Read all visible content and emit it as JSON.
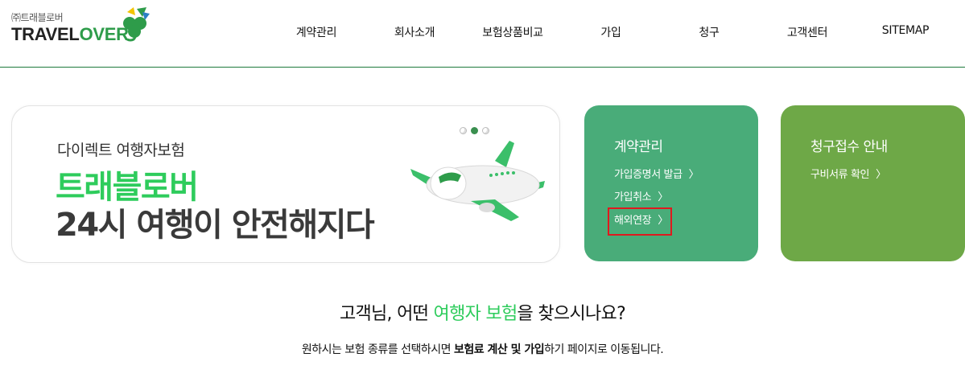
{
  "logo": {
    "small": "㈜트래블로버",
    "main_a": "TRAVEL",
    "main_b": "OVER"
  },
  "nav": [
    {
      "label": "계약관리"
    },
    {
      "label": "회사소개"
    },
    {
      "label": "보험상품비교"
    },
    {
      "label": "가입"
    },
    {
      "label": "청구"
    },
    {
      "label": "고객센터"
    },
    {
      "label": "SITEMAP"
    }
  ],
  "banner": {
    "subtitle": "다이렉트 여행자보험",
    "title": "트래블로버",
    "title2": "24시 여행이 안전해지다",
    "active_slide": 2,
    "slide_count": 3
  },
  "cards": {
    "contract": {
      "title": "계약관리",
      "links": [
        "가입증명서 발급",
        "가입취소",
        "해외연장"
      ]
    },
    "claim": {
      "title": "청구접수 안내",
      "links": [
        "구비서류 확인"
      ]
    },
    "arrow": "〉"
  },
  "question": {
    "pre": "고객님, 어떤 ",
    "highlight": "여행자 보험",
    "post": "을 찾으시나요?"
  },
  "description": {
    "pre": "원하시는 보험 종류를 선택하시면 ",
    "bold": "보험료 계산 및 가입",
    "post": "하기 페이지로 이동됩니다."
  },
  "colors": {
    "brand_green": "#2ecc5c",
    "contract_card": "#49ac79",
    "claim_card": "#6ea847",
    "highlight_box": "#e0191e"
  }
}
